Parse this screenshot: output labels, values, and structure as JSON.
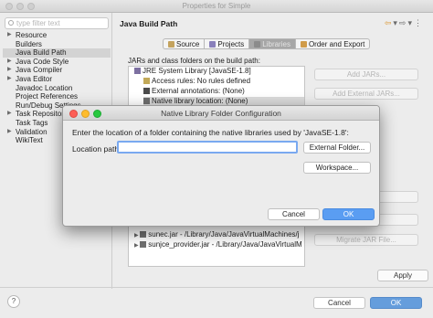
{
  "background_window": {
    "title": "Properties for Simple",
    "filter_placeholder": "type filter text",
    "tree_items": [
      {
        "label": "Resource",
        "expandable": true
      },
      {
        "label": "Builders",
        "expandable": false
      },
      {
        "label": "Java Build Path",
        "expandable": false,
        "selected": true
      },
      {
        "label": "Java Code Style",
        "expandable": true
      },
      {
        "label": "Java Compiler",
        "expandable": true
      },
      {
        "label": "Java Editor",
        "expandable": true
      },
      {
        "label": "Javadoc Location",
        "expandable": false
      },
      {
        "label": "Project References",
        "expandable": false
      },
      {
        "label": "Run/Debug Settings",
        "expandable": false
      },
      {
        "label": "Task Repository",
        "expandable": true
      },
      {
        "label": "Task Tags",
        "expandable": false
      },
      {
        "label": "Validation",
        "expandable": true
      },
      {
        "label": "WikiText",
        "expandable": false
      }
    ],
    "page_title": "Java Build Path",
    "tabs": [
      {
        "label": "Source",
        "active": false
      },
      {
        "label": "Projects",
        "active": false
      },
      {
        "label": "Libraries",
        "active": true
      },
      {
        "label": "Order and Export",
        "active": false
      }
    ],
    "jars_label": "JARs and class folders on the build path:",
    "library_items": [
      {
        "label": "JRE System Library [JavaSE-1.8]",
        "selected": false
      },
      {
        "label": "Access rules: No rules defined",
        "selected": false
      },
      {
        "label": "External annotations: (None)",
        "selected": false
      },
      {
        "label": "Native library location: (None)",
        "selected": true
      },
      {
        "label": "sunec.jar - /Library/Java/JavaVirtualMachines/j",
        "selected": false
      },
      {
        "label": "sunjce_provider.jar - /Library/Java/JavaVirtualM",
        "selected": false
      }
    ],
    "side_buttons": {
      "add_jars": "Add JARs...",
      "add_external_jars": "Add External JARs...",
      "migrate_jar": "Migrate JAR File..."
    },
    "apply_label": "Apply",
    "help_label": "?",
    "cancel_label": "Cancel",
    "ok_label": "OK"
  },
  "dialog": {
    "title": "Native Library Folder Configuration",
    "message": "Enter the location of a folder containing the native libraries used by 'JavaSE-1.8':",
    "location_label": "Location path:",
    "location_value": "",
    "external_folder_label": "External Folder...",
    "workspace_label": "Workspace...",
    "cancel_label": "Cancel",
    "ok_label": "OK"
  },
  "colors": {
    "accent": "#5a9df2",
    "focus_ring": "#7aa9f0",
    "close_light": "#fd5f57",
    "minimize_light": "#febc2e",
    "zoom_light": "#28c840"
  }
}
